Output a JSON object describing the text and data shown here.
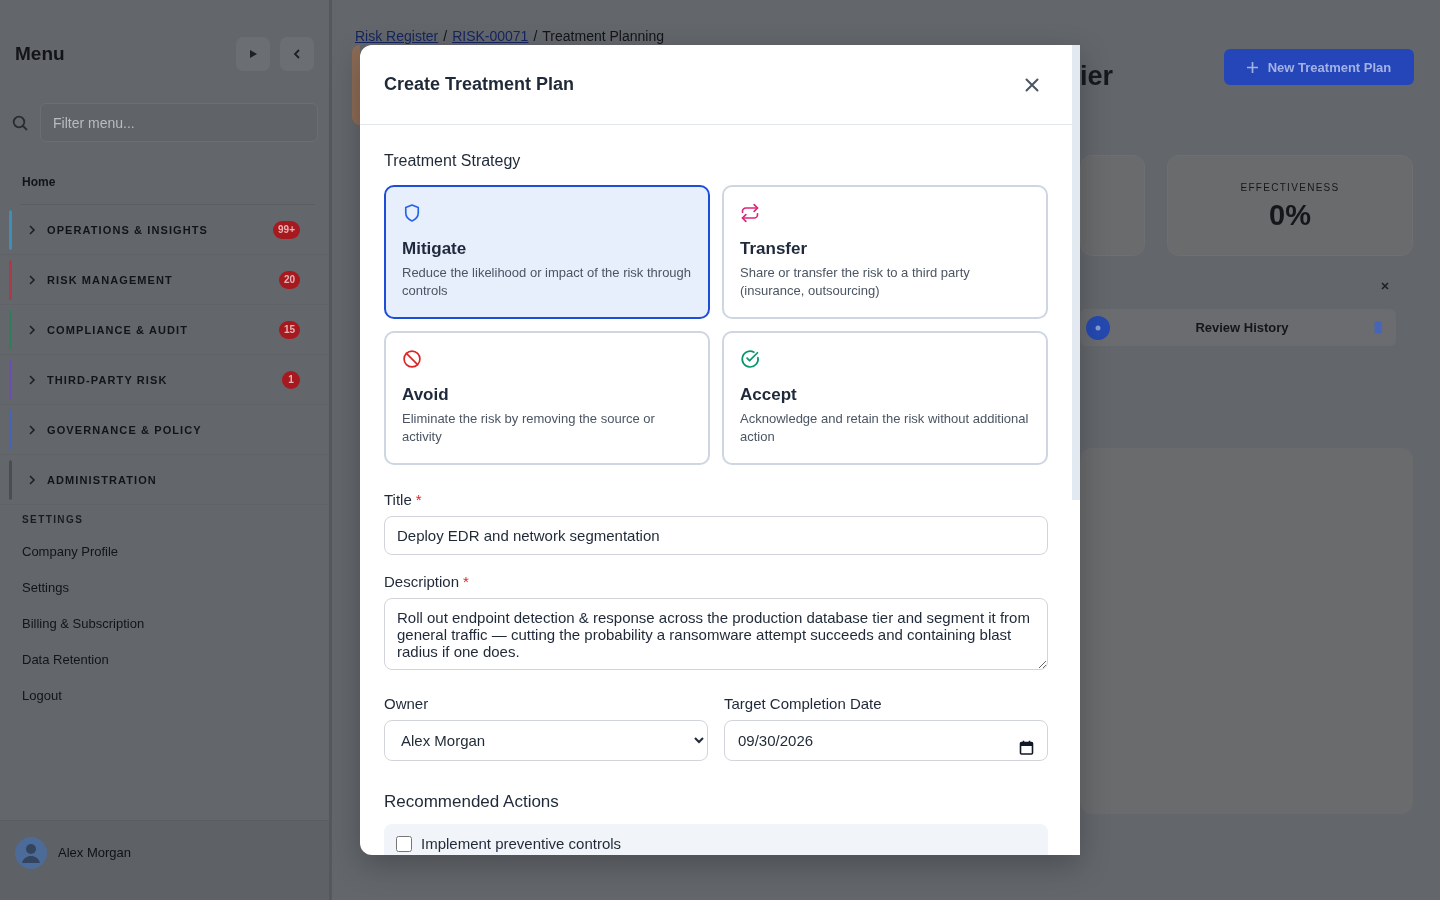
{
  "sidebar": {
    "title": "Menu",
    "search": {
      "placeholder": "Filter menu..."
    },
    "home": "Home",
    "sections": [
      {
        "label": "OPERATIONS & INSIGHTS",
        "badge": "99+",
        "color": "#3b8fb8",
        "expanded": false
      },
      {
        "label": "RISK MANAGEMENT",
        "badge": "20",
        "color": "#a83c48",
        "expanded": false
      },
      {
        "label": "COMPLIANCE & AUDIT",
        "badge": "15",
        "color": "#2f7f5c",
        "expanded": false
      },
      {
        "label": "THIRD-PARTY RISK",
        "badge": "1",
        "color": "#6b4fb3",
        "expanded": false
      },
      {
        "label": "GOVERNANCE & POLICY",
        "color": "#4765b8",
        "expanded": false
      },
      {
        "label": "ADMINISTRATION",
        "color": "#4a4d52",
        "expanded": false
      }
    ],
    "settings_heading": "SETTINGS",
    "settings_items": [
      "Company Profile",
      "Settings",
      "Billing & Subscription",
      "Data Retention",
      "Logout"
    ],
    "user": {
      "name": "Alex Morgan"
    }
  },
  "page": {
    "breadcrumb": [
      {
        "label": "Risk Register",
        "link": true
      },
      {
        "label": "RISK-00071",
        "link": true
      },
      {
        "label": "Treatment Planning",
        "link": false
      }
    ],
    "separator": "/",
    "title_fragment": "ier",
    "new_button": "New Treatment Plan",
    "stat": {
      "label": "EFFECTIVENESS",
      "value": "0%"
    },
    "review_row": {
      "label": "Review History"
    }
  },
  "modal": {
    "title": "Create Treatment Plan",
    "strategy_heading": "Treatment Strategy",
    "strategies": [
      {
        "kind": "shield",
        "name": "Mitigate",
        "description": "Reduce the likelihood or impact of the risk through controls",
        "selected": true
      },
      {
        "kind": "swap",
        "name": "Transfer",
        "description": "Share or transfer the risk to a third party (insurance, outsourcing)",
        "selected": false
      },
      {
        "kind": "ban",
        "name": "Avoid",
        "description": "Eliminate the risk by removing the source or activity",
        "selected": false
      },
      {
        "kind": "check",
        "name": "Accept",
        "description": "Acknowledge and retain the risk without additional action",
        "selected": false
      }
    ],
    "title_field": {
      "label": "Title",
      "required_mark": "*",
      "value": "Deploy EDR and network segmentation"
    },
    "description_field": {
      "label": "Description",
      "required_mark": "*",
      "value": "Roll out endpoint detection & response across the production database tier and segment it from general traffic — cutting the probability a ransomware attempt succeeds and containing blast radius if one does."
    },
    "owner_field": {
      "label": "Owner",
      "value": "Alex Morgan"
    },
    "date_field": {
      "label": "Target Completion Date",
      "value": "09/30/2026"
    },
    "actions_heading": "Recommended Actions",
    "actions": [
      {
        "label": "Implement preventive controls",
        "checked": false
      }
    ]
  }
}
